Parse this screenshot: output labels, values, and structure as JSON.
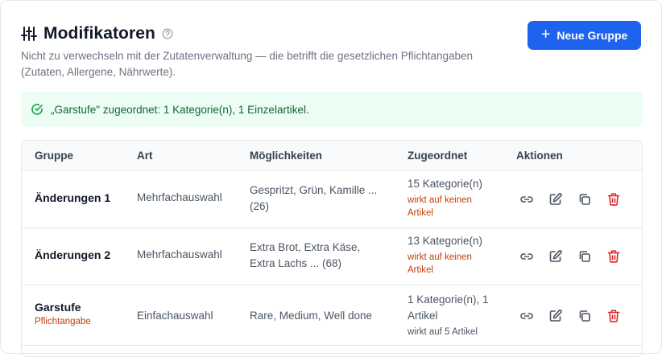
{
  "header": {
    "title": "Modifikatoren",
    "subtitle": "Nicht zu verwechseln mit der Zutatenverwaltung — die betrifft die gesetzlichen Pflichtangaben (Zutaten, Allergene, Nährwerte).",
    "new_group_label": "Neue Gruppe",
    "new_group_icon": "plus-icon"
  },
  "alert": {
    "text": "„Garstufe\" zugeordnet: 1 Kategorie(n), 1 Einzelartikel.",
    "icon": "check-circle-icon",
    "color": "#166534"
  },
  "table": {
    "columns": {
      "group": "Gruppe",
      "type": "Art",
      "options": "Möglichkeiten",
      "assigned": "Zugeordnet",
      "actions": "Aktionen"
    },
    "rows": [
      {
        "name": "Änderungen 1",
        "tag": "",
        "type": "Mehrfachauswahl",
        "options_line1": "Gespritzt, Grün, Kamille ...",
        "options_line2": "(26)",
        "assigned_line1": "15 Kategorie(n)",
        "assigned_line2": "",
        "note_line1": "wirkt auf keinen",
        "note_line2": "Artikel"
      },
      {
        "name": "Änderungen 2",
        "tag": "",
        "type": "Mehrfachauswahl",
        "options_line1": "Extra Brot, Extra Käse,",
        "options_line2": "Extra Lachs ... (68)",
        "assigned_line1": "13 Kategorie(n)",
        "assigned_line2": "",
        "note_line1": "wirkt auf keinen",
        "note_line2": "Artikel"
      },
      {
        "name": "Garstufe",
        "tag": "Pflichtangabe",
        "type": "Einfachauswahl",
        "options_line1": "Rare, Medium, Well done",
        "options_line2": "",
        "assigned_line1": "1 Kategorie(n), 1",
        "assigned_line2": "Artikel",
        "note_line1": "wirkt auf 5 Artikel",
        "note_line2": ""
      }
    ],
    "action_icons": [
      "link-icon",
      "edit-icon",
      "copy-icon",
      "trash-icon"
    ]
  },
  "colors": {
    "primary": "#1d63ed",
    "success_bg": "#ecfdf3",
    "warning_text": "#c2410c",
    "danger": "#dc2626"
  }
}
